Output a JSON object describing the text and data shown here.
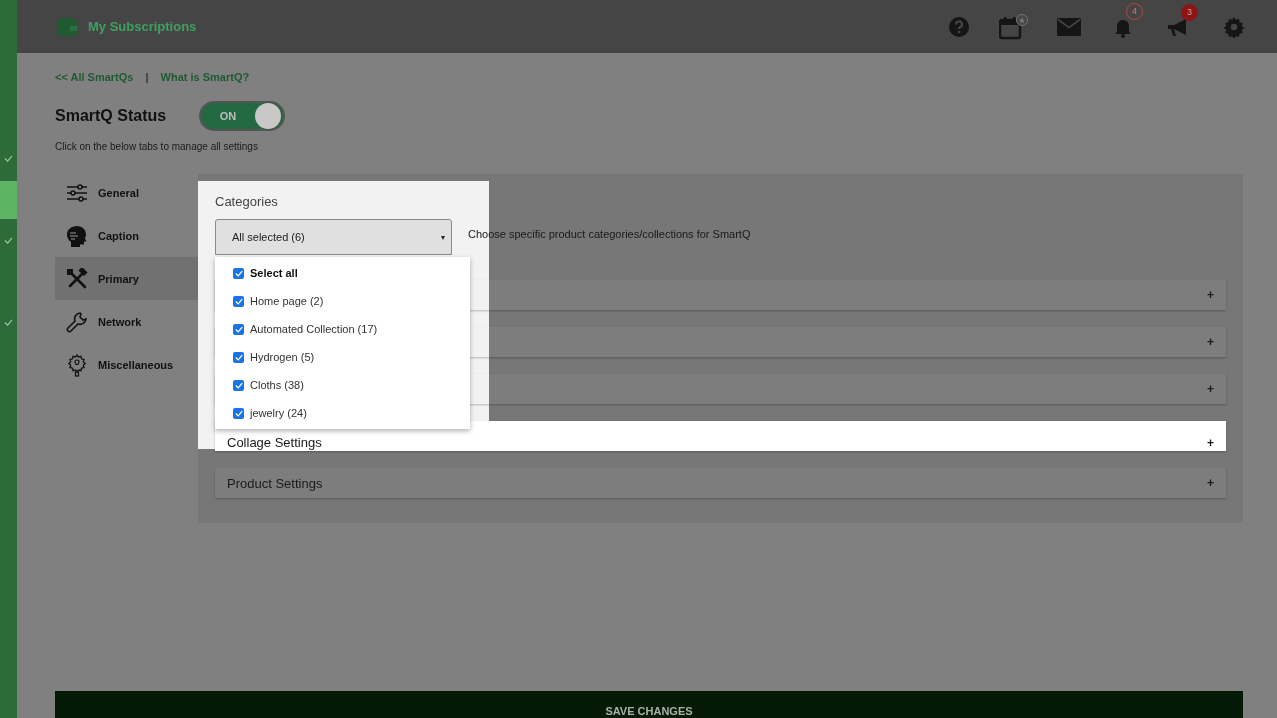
{
  "rail": {
    "items": [
      {
        "checked": true,
        "selected": false
      },
      {
        "checked": false,
        "selected": true
      },
      {
        "checked": true,
        "selected": false
      },
      {
        "checked": false,
        "selected": false
      },
      {
        "checked": true,
        "selected": false
      }
    ]
  },
  "header": {
    "title": "My Subscriptions",
    "actions": [
      {
        "kind": "help"
      },
      {
        "kind": "calendar"
      },
      {
        "kind": "mail"
      },
      {
        "kind": "bell",
        "badge": "4"
      },
      {
        "kind": "megaphone",
        "badge": "3"
      },
      {
        "kind": "settings"
      }
    ]
  },
  "breadcrumbs": {
    "links": [
      "<< All SmartQs",
      "What is SmartQ?"
    ],
    "separator": "|"
  },
  "status": {
    "title": "SmartQ Status",
    "on": true,
    "label": "ON",
    "hint": "Click on the below tabs to manage all settings"
  },
  "tabs": [
    {
      "label": "General",
      "kind": "sliders",
      "selected": false
    },
    {
      "label": "Caption",
      "kind": "head",
      "selected": false
    },
    {
      "label": "Primary",
      "kind": "tools",
      "selected": true
    },
    {
      "label": "Network",
      "kind": "wrench",
      "selected": false
    },
    {
      "label": "Miscellaneous",
      "kind": "bulb",
      "selected": false
    }
  ],
  "categories": {
    "label": "Categories",
    "value": "All selected (6)",
    "description": "Choose specific product categories/collections for SmartQ",
    "expanded": true,
    "caret": "▾",
    "options": [
      {
        "label": "Select all",
        "kind": "all",
        "checked": true
      },
      {
        "label": "Home page (2)",
        "kind": "item",
        "checked": true
      },
      {
        "label": "Automated Collection (17)",
        "kind": "item",
        "checked": true
      },
      {
        "label": "Hydrogen (5)",
        "kind": "item",
        "checked": true
      },
      {
        "label": "Cloths (38)",
        "kind": "item",
        "checked": true
      },
      {
        "label": "jewelry (24)",
        "kind": "item",
        "checked": true
      }
    ]
  },
  "sections": [
    {
      "toggle": "+"
    },
    {
      "toggle": "+"
    },
    {
      "toggle": "+"
    },
    {
      "title": "Collage Settings",
      "toggle": "+",
      "spotlit": true
    },
    {
      "title": "Product Settings",
      "toggle": "+",
      "spotlit": false
    }
  ],
  "save_button": "SAVE CHANGES"
}
